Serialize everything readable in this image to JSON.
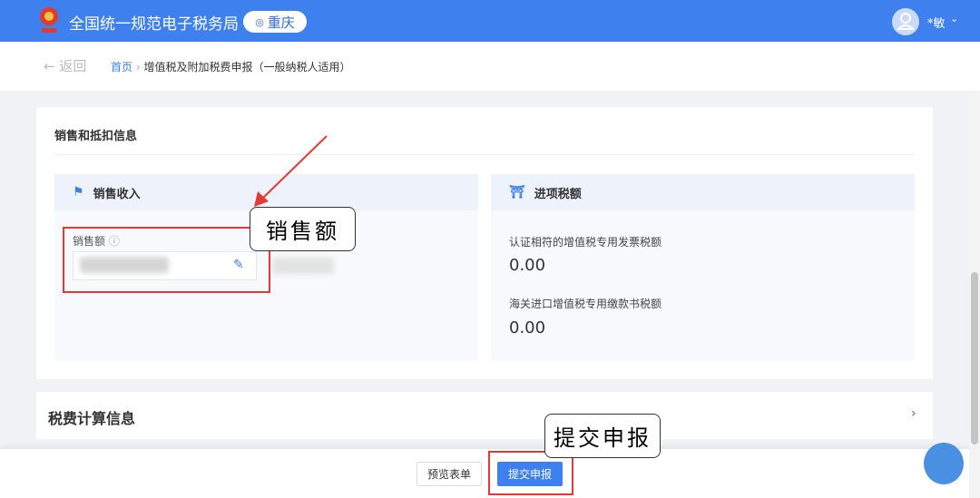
{
  "header": {
    "site_title": "全国统一规范电子税务局",
    "city": "重庆",
    "user": "*敏"
  },
  "breadcrumb": {
    "back": "返回",
    "home": "首页",
    "current": "增值税及附加税费申报（一般纳税人适用）"
  },
  "sales_section": {
    "title": "销售和抵扣信息",
    "sales_income": {
      "title": "销售收入",
      "field_label": "销售额"
    },
    "input_tax": {
      "title": "进项税额",
      "items": [
        {
          "label": "认证相符的增值税专用发票税额",
          "value": "0.00"
        },
        {
          "label": "海关进口增值税专用缴款书税额",
          "value": "0.00"
        }
      ]
    }
  },
  "calc_section": {
    "title": "税费计算信息"
  },
  "footer": {
    "preview": "预览表单",
    "submit": "提交申报"
  },
  "annotations": {
    "sales_callout": "销售额",
    "submit_callout": "提交申报"
  }
}
